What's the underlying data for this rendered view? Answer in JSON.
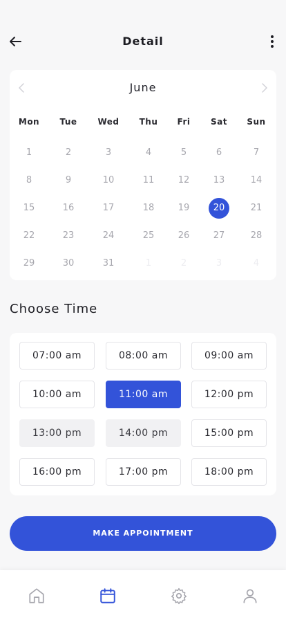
{
  "header": {
    "title": "Detail"
  },
  "calendar": {
    "month": "June",
    "weekdays": [
      "Mon",
      "Tue",
      "Wed",
      "Thu",
      "Fri",
      "Sat",
      "Sun"
    ],
    "weeks": [
      [
        "1",
        "2",
        "3",
        "4",
        "5",
        "6",
        "7"
      ],
      [
        "8",
        "9",
        "10",
        "11",
        "12",
        "13",
        "14"
      ],
      [
        "15",
        "16",
        "17",
        "18",
        "19",
        "20",
        "21"
      ],
      [
        "22",
        "23",
        "24",
        "25",
        "26",
        "27",
        "28"
      ],
      [
        "29",
        "30",
        "31",
        "1",
        "2",
        "3",
        "4"
      ]
    ],
    "selected_day": "20"
  },
  "time": {
    "title": "Choose Time",
    "slots": [
      [
        "07:00 am",
        "08:00 am",
        "09:00 am"
      ],
      [
        "10:00 am",
        "11:00 am",
        "12:00 pm"
      ],
      [
        "13:00 pm",
        "14:00 pm",
        "15:00 pm"
      ],
      [
        "16:00 pm",
        "17:00 pm",
        "18:00 pm"
      ]
    ],
    "selected": "11:00 am",
    "unavailable": [
      "13:00 pm",
      "14:00 pm"
    ]
  },
  "cta": {
    "label": "MAKE APPOINTMENT"
  },
  "nav": {
    "items": [
      {
        "icon": "home-icon"
      },
      {
        "icon": "calendar-icon",
        "active": true
      },
      {
        "icon": "gear-icon"
      },
      {
        "icon": "user-icon"
      }
    ]
  },
  "colors": {
    "accent": "#3353d9",
    "muted": "#a7a7ae",
    "background": "#f7f7f8"
  }
}
